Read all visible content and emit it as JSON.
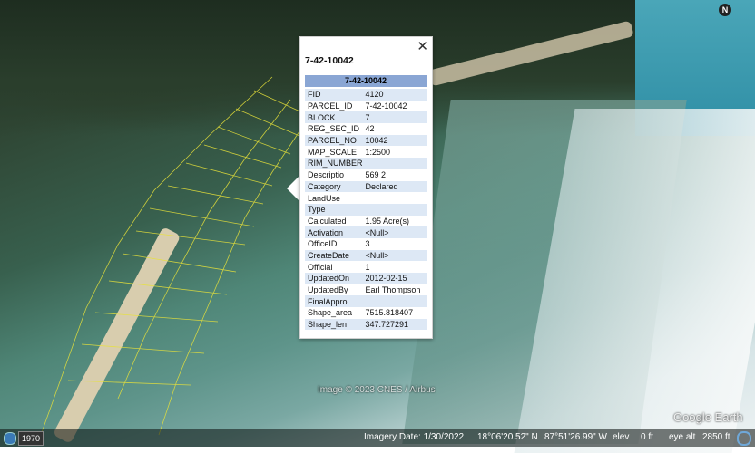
{
  "map": {
    "attribution": "Image © 2023 CNES / Airbus",
    "brand": "Google Earth",
    "north_label": "N"
  },
  "statusbar": {
    "year": "1970",
    "imagery_date": "Imagery Date: 1/30/2022",
    "latitude": "18°06'20.52\" N",
    "longitude": "87°51'26.99\" W",
    "elev_label": "elev",
    "elev_value": "0 ft",
    "eye_alt_label": "eye alt",
    "eye_alt_value": "2850 ft"
  },
  "popup": {
    "title": "7-42-10042",
    "header": "7-42-10042",
    "close_glyph": "✕",
    "rows": [
      {
        "key": "FID",
        "value": "4120"
      },
      {
        "key": "PARCEL_ID",
        "value": "7-42-10042"
      },
      {
        "key": "BLOCK",
        "value": "7"
      },
      {
        "key": "REG_SEC_ID",
        "value": "42"
      },
      {
        "key": "PARCEL_NO",
        "value": "10042"
      },
      {
        "key": "MAP_SCALE",
        "value": "1:2500"
      },
      {
        "key": "RIM_NUMBER",
        "value": ""
      },
      {
        "key": "Descriptio",
        "value": "569 2"
      },
      {
        "key": "Category",
        "value": "Declared"
      },
      {
        "key": "LandUse",
        "value": ""
      },
      {
        "key": "Type",
        "value": ""
      },
      {
        "key": "Calculated",
        "value": "1.95 Acre(s)"
      },
      {
        "key": "Activation",
        "value": "<Null>"
      },
      {
        "key": "OfficeID",
        "value": "3"
      },
      {
        "key": "CreateDate",
        "value": "<Null>"
      },
      {
        "key": "Official",
        "value": "1"
      },
      {
        "key": "UpdatedOn",
        "value": "2012-02-15"
      },
      {
        "key": "UpdatedBy",
        "value": "Earl Thompson"
      },
      {
        "key": "FinalAppro",
        "value": ""
      },
      {
        "key": "Shape_area",
        "value": "7515.818407"
      },
      {
        "key": "Shape_len",
        "value": "347.727291"
      }
    ]
  },
  "colors": {
    "header_bg": "#8aa6d4",
    "row_stripe": "#dde8f5",
    "parcel_line": "#e8e23a"
  }
}
